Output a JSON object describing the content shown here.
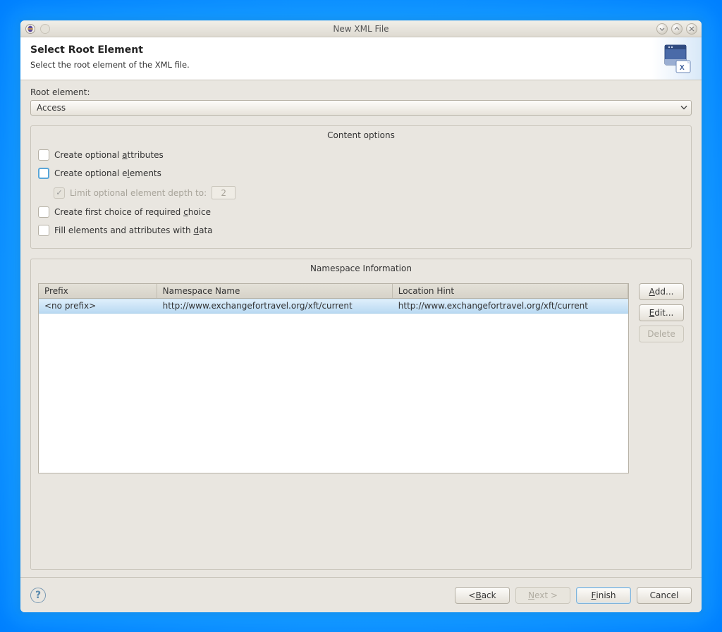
{
  "titlebar": {
    "title": "New XML File"
  },
  "header": {
    "title": "Select Root Element",
    "subtitle": "Select the root element of the XML file."
  },
  "root_element": {
    "label": "Root element:",
    "value": "Access"
  },
  "content_options": {
    "title": "Content options",
    "create_attributes": {
      "label_pre": "Create optional ",
      "u": "a",
      "label_post": "ttributes",
      "checked": false
    },
    "create_elements": {
      "label_pre": "Create optional e",
      "u": "l",
      "label_post": "ements",
      "checked": false
    },
    "limit_depth": {
      "label": "Limit optional element depth to:",
      "value": "2",
      "checked": true,
      "disabled": true
    },
    "first_choice": {
      "label_pre": "Create first choice of required ",
      "u": "c",
      "label_post": "hoice",
      "checked": false
    },
    "fill_data": {
      "label_pre": "Fill elements and attributes with ",
      "u": "d",
      "label_post": "ata",
      "checked": false
    }
  },
  "namespace": {
    "title": "Namespace Information",
    "columns": {
      "prefix": "Prefix",
      "name": "Namespace Name",
      "hint": "Location Hint"
    },
    "rows": [
      {
        "prefix": "<no prefix>",
        "name": "http://www.exchangefortravel.org/xft/current",
        "hint": "http://www.exchangefortravel.org/xft/current"
      }
    ],
    "buttons": {
      "add": {
        "u": "A",
        "rest": "dd..."
      },
      "edit": {
        "u": "E",
        "rest": "dit..."
      },
      "delete": "Delete"
    }
  },
  "footer": {
    "back": {
      "lt": "< ",
      "u": "B",
      "rest": "ack"
    },
    "next": {
      "u": "N",
      "rest": "ext >"
    },
    "finish": {
      "u": "F",
      "rest": "inish"
    },
    "cancel": "Cancel"
  }
}
